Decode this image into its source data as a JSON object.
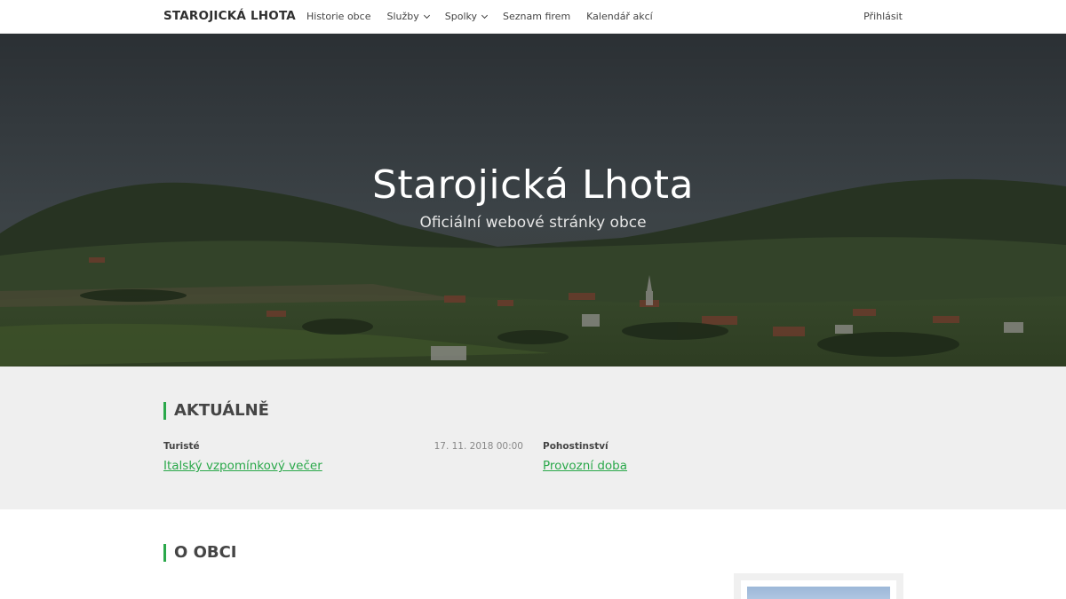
{
  "navbar": {
    "brand": "STAROJICKÁ LHOTA",
    "items": [
      {
        "label": "Historie obce",
        "dropdown": false
      },
      {
        "label": "Služby",
        "dropdown": true
      },
      {
        "label": "Spolky",
        "dropdown": true
      },
      {
        "label": "Seznam firem",
        "dropdown": false
      },
      {
        "label": "Kalendář akcí",
        "dropdown": false
      }
    ],
    "login_label": "Přihlásit"
  },
  "hero": {
    "title": "Starojická Lhota",
    "subtitle": "Oficiální webové stránky obce"
  },
  "news": {
    "title": "AKTUÁLNĚ",
    "items": [
      {
        "category": "Turisté",
        "date": "17. 11. 2018 00:00",
        "link": "Italský vzpomínkový večer"
      },
      {
        "category": "Pohostinství",
        "date": "",
        "link": "Provozní doba"
      }
    ]
  },
  "about": {
    "title": "O OBCI"
  },
  "colors": {
    "accent": "#2aa84a",
    "news_bg": "#efefef"
  }
}
